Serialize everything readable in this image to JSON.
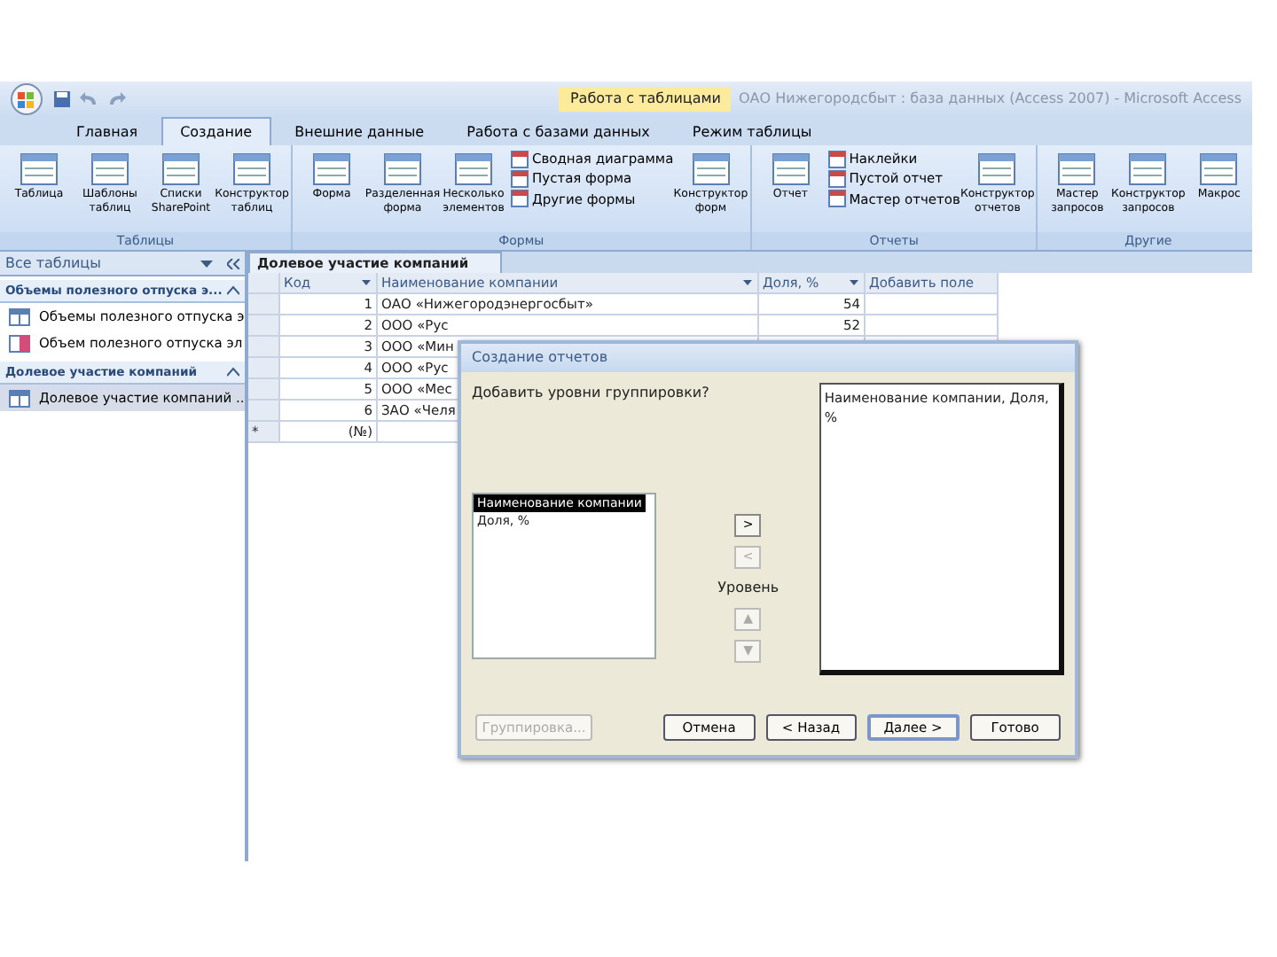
{
  "title_bar": {
    "context_tab": "Работа с таблицами",
    "title": "ОАО Нижегородсбыт : база данных (Access 2007) - Microsoft Access"
  },
  "ribbon_tabs": [
    {
      "label": "Главная",
      "selected": false
    },
    {
      "label": "Создание",
      "selected": true
    },
    {
      "label": "Внешние данные",
      "selected": false
    },
    {
      "label": "Работа с базами данных",
      "selected": false
    },
    {
      "label": "Режим таблицы",
      "selected": false
    }
  ],
  "ribbon_groups": [
    {
      "label": "Таблицы",
      "buttons": [
        {
          "kind": "large",
          "label": "Таблица"
        },
        {
          "kind": "large",
          "label": "Шаблоны таблиц"
        },
        {
          "kind": "large",
          "label": "Списки SharePoint"
        },
        {
          "kind": "large",
          "label": "Конструктор таблиц"
        }
      ]
    },
    {
      "label": "Формы",
      "buttons": [
        {
          "kind": "large",
          "label": "Форма"
        },
        {
          "kind": "large",
          "label": "Разделенная форма"
        },
        {
          "kind": "large",
          "label": "Несколько элементов"
        },
        {
          "kind": "small",
          "label": "Сводная диаграмма"
        },
        {
          "kind": "small",
          "label": "Пустая форма"
        },
        {
          "kind": "small",
          "label": "Другие формы"
        },
        {
          "kind": "large",
          "label": "Конструктор форм"
        }
      ]
    },
    {
      "label": "Отчеты",
      "buttons": [
        {
          "kind": "large",
          "label": "Отчет"
        },
        {
          "kind": "small",
          "label": "Наклейки"
        },
        {
          "kind": "small",
          "label": "Пустой отчет"
        },
        {
          "kind": "small",
          "label": "Мастер отчетов"
        },
        {
          "kind": "large",
          "label": "Конструктор отчетов"
        }
      ]
    },
    {
      "label": "Другие",
      "buttons": [
        {
          "kind": "large",
          "label": "Мастер запросов"
        },
        {
          "kind": "large",
          "label": "Конструктор запросов"
        },
        {
          "kind": "large",
          "label": "Макрос"
        }
      ]
    }
  ],
  "nav_pane": {
    "title": "Все таблицы",
    "groups": [
      {
        "label": "Объемы полезного отпуска э...",
        "items": [
          {
            "label": "Объемы полезного отпуска э",
            "kind": "table",
            "selected": false
          },
          {
            "label": "Объем полезного отпуска эл",
            "kind": "query",
            "selected": false
          }
        ]
      },
      {
        "label": "Долевое участие компаний",
        "items": [
          {
            "label": "Долевое участие компаний ...",
            "kind": "table",
            "selected": true
          }
        ]
      }
    ]
  },
  "document_tab": "Долевое участие компаний",
  "table": {
    "columns": [
      "Код",
      "Наименование компании",
      "Доля, %",
      "Добавить поле"
    ],
    "rows": [
      {
        "code": "1",
        "name": "ОАО «Нижегородэнергосбыт»",
        "share": "54"
      },
      {
        "code": "2",
        "name": "ООО «Рус",
        "share": "52"
      },
      {
        "code": "3",
        "name": "ООО «Мин"
      },
      {
        "code": "4",
        "name": "ООО «Рус"
      },
      {
        "code": "5",
        "name": "ООО «Мес"
      },
      {
        "code": "6",
        "name": "ЗАО «Челя"
      }
    ],
    "new_row": {
      "marker": "*",
      "code": "(№)"
    }
  },
  "dialog": {
    "title": "Создание отчетов",
    "question": "Добавить уровни группировки?",
    "fields": [
      {
        "label": "Наименование компании",
        "selected": true
      },
      {
        "label": "Доля, %",
        "selected": false
      }
    ],
    "move_buttons": [
      {
        "label": ">",
        "disabled": false
      },
      {
        "label": "<",
        "disabled": true
      }
    ],
    "priority_label": "Уровень",
    "priority_buttons": [
      {
        "label": "▲",
        "disabled": true
      },
      {
        "label": "▼",
        "disabled": true
      }
    ],
    "preview": "Наименование компании, Доля, %",
    "buttons": [
      {
        "label": "Группировка...",
        "disabled": true,
        "default": false
      },
      {
        "label": "Отмена",
        "disabled": false,
        "default": false
      },
      {
        "label": "< Назад",
        "disabled": false,
        "default": false
      },
      {
        "label": "Далее >",
        "disabled": false,
        "default": true
      },
      {
        "label": "Готово",
        "disabled": false,
        "default": false
      }
    ]
  }
}
